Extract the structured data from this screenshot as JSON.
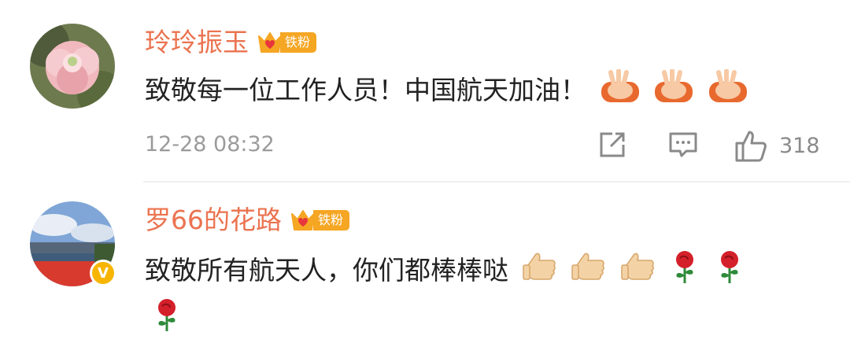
{
  "comments": [
    {
      "username": "玲玲振玉",
      "fan_badge": "铁粉",
      "text": "致敬每一位工作人员！中国航天加油！",
      "emojis": [
        "victory-hands-icon",
        "victory-hands-icon",
        "victory-hands-icon"
      ],
      "timestamp": "12-28 08:32",
      "like_count": "318"
    },
    {
      "username": "罗66的花路",
      "fan_badge": "铁粉",
      "verified": true,
      "text": "致敬所有航天人，你们都棒棒哒",
      "emojis": [
        "thumbs-up-icon",
        "thumbs-up-icon",
        "thumbs-up-icon",
        "rose-icon",
        "rose-icon"
      ],
      "wrap_emojis": [
        "rose-icon"
      ]
    }
  ],
  "colors": {
    "username": "#eb7350",
    "badge": "#f5a623",
    "meta": "#9b9b9b",
    "text": "#222222"
  }
}
